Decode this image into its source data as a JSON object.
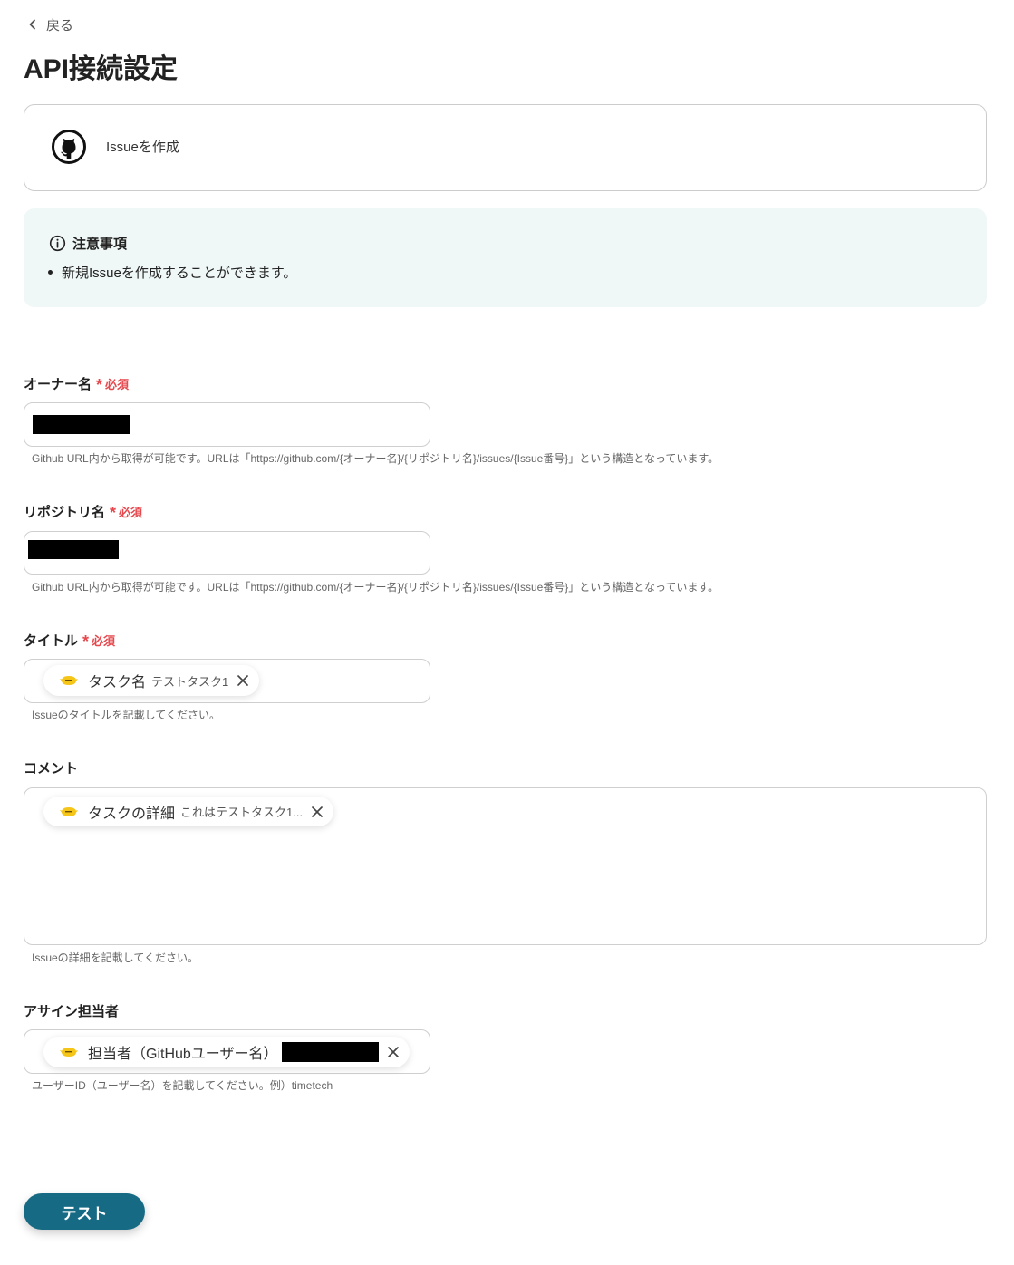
{
  "nav": {
    "back_label": "戻る",
    "back_icon": "chevron-left-icon"
  },
  "page": {
    "title": "API接続設定"
  },
  "action_card": {
    "icon": "github-icon",
    "label": "Issueを作成"
  },
  "notice": {
    "icon": "info-icon",
    "heading": "注意事項",
    "items": [
      "新規Issueを作成することができます。"
    ]
  },
  "form": {
    "required_mark": "*",
    "required_label": "必須",
    "owner": {
      "label": "オーナー名",
      "required": true,
      "help": "Github URL内から取得が可能です。URLは「https://github.com/{オーナー名}/{リポジトリ名}/issues/{Issue番号}」という構造となっています。"
    },
    "repository": {
      "label": "リポジトリ名",
      "required": true,
      "help": "Github URL内から取得が可能です。URLは「https://github.com/{オーナー名}/{リポジトリ名}/issues/{Issue番号}」という構造となっています。"
    },
    "title": {
      "label": "タイトル",
      "required": true,
      "chip": {
        "icon": "app-logo-icon",
        "name": "タスク名",
        "value": "テストタスク1"
      },
      "help": "Issueのタイトルを記載してください。"
    },
    "comment": {
      "label": "コメント",
      "required": false,
      "chip": {
        "icon": "app-logo-icon",
        "name": "タスクの詳細",
        "value": "これはテストタスク1..."
      },
      "help": "Issueの詳細を記載してください。"
    },
    "assignee": {
      "label": "アサイン担当者",
      "required": false,
      "chip": {
        "icon": "app-logo-icon",
        "name": "担当者（GitHubユーザー名）"
      },
      "help": "ユーザーID（ユーザー名）を記載してください。例）timetech"
    }
  },
  "actions": {
    "test_label": "テスト"
  },
  "colors": {
    "primary_button": "#176a84",
    "required": "#e5484d",
    "notice_background": "#f0f8f7",
    "chip_logo": "#f5c518"
  }
}
